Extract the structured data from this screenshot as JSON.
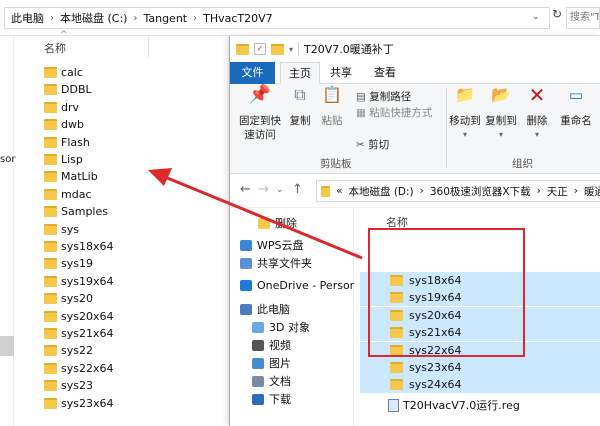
{
  "back_window": {
    "breadcrumb": [
      "此电脑",
      "本地磁盘 (C:)",
      "Tangent",
      "THvacT20V7"
    ],
    "search_placeholder": "搜索\"TH",
    "column_header": "名称",
    "left_partial": "sor",
    "files": [
      "calc",
      "DDBL",
      "drv",
      "dwb",
      "Flash",
      "Lisp",
      "MatLib",
      "mdac",
      "Samples",
      "sys",
      "sys18x64",
      "sys19",
      "sys19x64",
      "sys20",
      "sys20x64",
      "sys21x64",
      "sys22",
      "sys22x64",
      "sys23",
      "sys23x64"
    ]
  },
  "front_window": {
    "title": "T20V7.0暖通补丁",
    "tabs": {
      "file": "文件",
      "home": "主页",
      "share": "共享",
      "view": "查看"
    },
    "ribbon": {
      "pin": "固定到快\n速访问",
      "copy": "复制",
      "paste": "粘贴",
      "copy_path": "复制路径",
      "paste_shortcut": "粘贴快捷方式",
      "cut": "剪切",
      "clipboard_group": "剪贴板",
      "move_to": "移动到",
      "copy_to": "复制到",
      "delete": "删除",
      "rename": "重命名",
      "organize_group": "组织"
    },
    "breadcrumb": [
      "«",
      "本地磁盘 (D:)",
      "360极速浏览器X下载",
      "天正",
      "暖通"
    ],
    "sidebar": [
      "删除",
      "WPS云盘",
      "共享文件夹",
      "OneDrive - Persor",
      "此电脑",
      "3D 对象",
      "视频",
      "图片",
      "文档",
      "下载"
    ],
    "column_header": "名称",
    "selected_folders": [
      "sys18x64",
      "sys19x64",
      "sys20x64",
      "sys21x64",
      "sys22x64",
      "sys23x64",
      "sys24x64"
    ],
    "reg_file": "T20HvacV7.0运行.reg"
  },
  "colors": {
    "accent": "#1a6bbf",
    "selection": "#cce8ff",
    "highlight": "#e0272b",
    "folder": "#f5c84c"
  }
}
